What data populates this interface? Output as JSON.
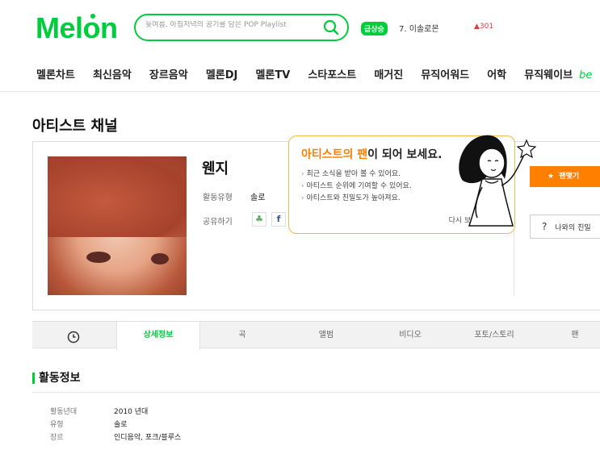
{
  "header": {
    "logo": "Melon",
    "search_placeholder": "늦여름, 아침저녁의 공기를 담은 POP Playlist",
    "hot_badge": "급상승",
    "hot_keyword": "7. 이솔로몬",
    "hot_rank": "▲301"
  },
  "nav": {
    "items": [
      "멜론차트",
      "최신음악",
      "장르음악",
      "멜론DJ",
      "멜론TV",
      "스타포스트",
      "매거진",
      "뮤직어워드",
      "어학",
      "뮤직웨이브"
    ],
    "extra": "be"
  },
  "page_title": "아티스트 채널",
  "artist": {
    "name": "웬지",
    "type_label": "활동유형",
    "type_value": "솔로",
    "share_label": "공유하기"
  },
  "popup": {
    "title_highlight": "아티스트의 팬",
    "title_rest": "이 되어 보세요.",
    "items": [
      "최근 소식을 받아 볼 수 있어요.",
      "아티스트 순위에 기여할 수 있어요.",
      "아티스트와 친밀도가 높아져요."
    ],
    "close_label": "다시 보지 않기"
  },
  "buttons": {
    "fan": "팬맺기",
    "friend": "나와의 친밀"
  },
  "tabs": [
    "상세정보",
    "곡",
    "앨범",
    "비디오",
    "포토/스토리",
    "팬"
  ],
  "activity": {
    "title": "활동정보",
    "rows": [
      {
        "label": "활동년대",
        "value": "2010 년대"
      },
      {
        "label": "유형",
        "value": "솔로"
      },
      {
        "label": "장르",
        "value": "인디음악, 포크/블루스"
      }
    ]
  },
  "colors": {
    "brand": "#00cd3c",
    "fan": "#ff7f00",
    "popup_border": "#f7b64a"
  }
}
